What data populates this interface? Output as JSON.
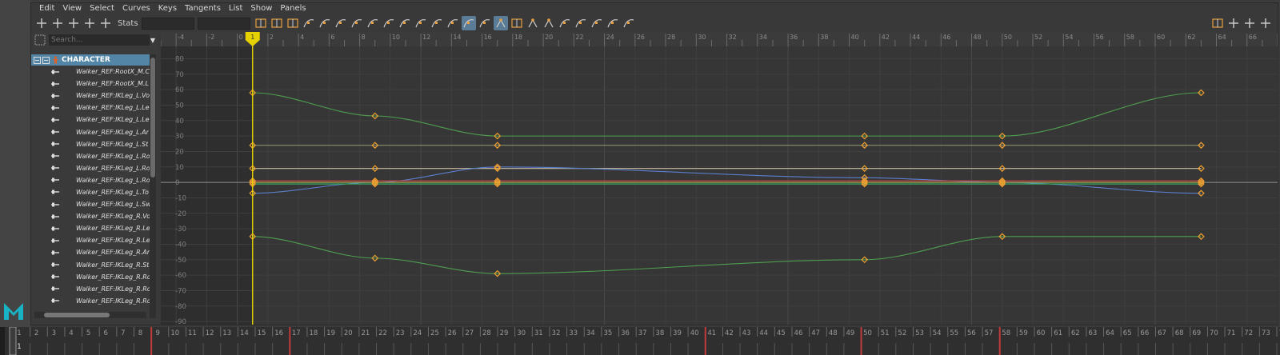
{
  "menu": [
    "Edit",
    "View",
    "Select",
    "Curves",
    "Keys",
    "Tangents",
    "List",
    "Show",
    "Panels"
  ],
  "toolbar": {
    "stats_label": "Stats",
    "left_icons": [
      "move-key-icon",
      "insert-key-icon",
      "lattice-icon",
      "region-tool-icon",
      "retime-tool-icon"
    ],
    "main_icons": [
      "frame-all-icon",
      "frame-playback-icon",
      "center-current-icon",
      "auto-tangent-icon",
      "spline-tangent-icon",
      "clamped-tangent-icon",
      "linear-tangent-icon",
      "flat-tangent-icon",
      "step-tangent-icon",
      "plateau-tangent-icon",
      "buffer-curve-icon",
      "break-tangents-icon",
      "unify-tangents-icon",
      "free-tangent-weight-icon",
      "lock-tangent-weight-icon",
      "auto-load-icon",
      "stacked-view-icon",
      "normalize-icon",
      "denormalize-icon",
      "pre-infinity-icon",
      "post-infinity-icon",
      "cycle-icon",
      "cycle-offset-icon",
      "curve-presets-icon"
    ],
    "right_icons": [
      "move-view-icon",
      "dope-sheet-icon",
      "trax-editor-icon",
      "camera-sequencer-icon"
    ]
  },
  "outliner": {
    "search_placeholder": "Search...",
    "root_label": "CHARACTER",
    "items": [
      "Walker_REF:RootX_M.C",
      "Walker_REF:RootX_M.L",
      "Walker_REF:IKLeg_L.Vo",
      "Walker_REF:IKLeg_L.Le",
      "Walker_REF:IKLeg_L.Le",
      "Walker_REF:IKLeg_L.Ar",
      "Walker_REF:IKLeg_L.St",
      "Walker_REF:IKLeg_L.Ro",
      "Walker_REF:IKLeg_L.Ro",
      "Walker_REF:IKLeg_L.Ro",
      "Walker_REF:IKLeg_L.To",
      "Walker_REF:IKLeg_L.Sw",
      "Walker_REF:IKLeg_R.Vo",
      "Walker_REF:IKLeg_R.Le",
      "Walker_REF:IKLeg_R.Le",
      "Walker_REF:IKLeg_R.Ar",
      "Walker_REF:IKLeg_R.St",
      "Walker_REF:IKLeg_R.Ro",
      "Walker_REF:IKLeg_R.Ro",
      "Walker_REF:IKLeg_R.Ro"
    ]
  },
  "graph": {
    "current_frame": "1",
    "current_frame_value": 1,
    "frame_range": [
      -5,
      68
    ],
    "value_range": [
      -92,
      88
    ],
    "frame_tick_step": 2,
    "value_tick_step": 10,
    "playback_start": 1,
    "colors": {
      "background": "#363636",
      "out_of_range": "#2e2e2e",
      "grid": "#3f3f3f",
      "grid_major": "#4a4a4a",
      "zero_line": "#8e8e8e",
      "key": "#f0a030",
      "time_marker": "#e6d200"
    },
    "curves": [
      {
        "color": "#4f9e4f",
        "keys": [
          [
            1,
            58
          ],
          [
            9,
            43
          ],
          [
            17,
            30
          ],
          [
            41,
            30
          ],
          [
            50,
            30
          ],
          [
            63,
            58
          ]
        ]
      },
      {
        "color": "#8c8c6c",
        "keys": [
          [
            1,
            24
          ],
          [
            9,
            24
          ],
          [
            17,
            24
          ],
          [
            41,
            24
          ],
          [
            50,
            24
          ],
          [
            63,
            24
          ]
        ]
      },
      {
        "color": "#c8c0a0",
        "keys": [
          [
            1,
            9
          ],
          [
            9,
            9
          ],
          [
            17,
            9
          ],
          [
            41,
            9
          ],
          [
            50,
            9
          ],
          [
            63,
            9
          ]
        ]
      },
      {
        "color": "#5a7fcc",
        "keys": [
          [
            1,
            -7
          ],
          [
            9,
            0
          ],
          [
            17,
            10
          ],
          [
            41,
            3
          ],
          [
            50,
            0
          ],
          [
            63,
            -7
          ]
        ]
      },
      {
        "color": "#d24646",
        "keys": [
          [
            1,
            1
          ],
          [
            9,
            1
          ],
          [
            17,
            1
          ],
          [
            41,
            1
          ],
          [
            50,
            1
          ],
          [
            63,
            1
          ]
        ]
      },
      {
        "color": "#a6a640",
        "keys": [
          [
            1,
            0
          ],
          [
            9,
            0
          ],
          [
            17,
            0
          ],
          [
            41,
            0
          ],
          [
            50,
            0
          ],
          [
            63,
            0
          ]
        ]
      },
      {
        "color": "#3fb86a",
        "keys": [
          [
            1,
            -1
          ],
          [
            9,
            -1
          ],
          [
            17,
            -1
          ],
          [
            41,
            -1
          ],
          [
            50,
            -1
          ],
          [
            63,
            -1
          ]
        ]
      },
      {
        "color": "#4f9e4f",
        "keys": [
          [
            1,
            -35
          ],
          [
            9,
            -49
          ],
          [
            17,
            -59
          ],
          [
            41,
            -50
          ],
          [
            50,
            -35
          ],
          [
            63,
            -35
          ]
        ]
      }
    ]
  },
  "timeslider": {
    "current_frame": "1",
    "frame_start": 1,
    "frame_end": 74,
    "key_frames": [
      9,
      17,
      41,
      50,
      58
    ]
  }
}
